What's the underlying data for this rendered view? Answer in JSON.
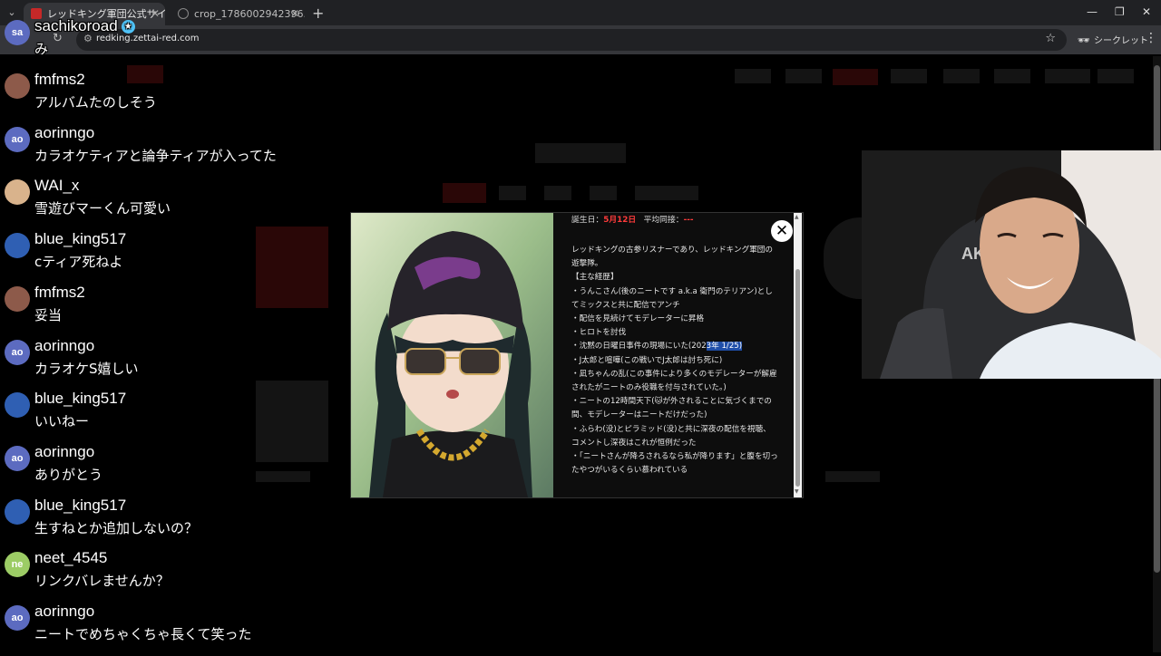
{
  "browser": {
    "tabs": [
      {
        "title": "レッドキング軍団公式サイト",
        "active": true
      },
      {
        "title": "crop_1786002942396.jpg (800×",
        "active": false
      }
    ],
    "url": "redking.zettai-red.com",
    "incognito_label": "シークレット"
  },
  "modal": {
    "birthday_label": "誕生日：",
    "birthday_value": "5月12日",
    "avg_label": "平均同接：",
    "avg_value": "---",
    "intro": "レッドキングの古参リスナーであり、レッドキング軍団の遊撃隊。",
    "section": "【主な経歴】",
    "bullets": [
      "・うんこさん(後のニートです a.k.a 衛門のテリアン)としてミックスと共に配信でアンチ",
      "・配信を見続けてモデレーターに昇格",
      "・ヒロトを討伐",
      "・J太郎と喧嘩(この戦いでJ太郎は討ち死に)",
      "・凪ちゃんの乱(この事件により多くのモデレーターが解雇されたがニートのみ役職を付与されていた。)",
      "・ニートの12時間天下(🐱が外されることに気づくまでの間、モデレーターはニートだけだった)",
      "・ふらわ(没)とピラミッド(没)と共に深夜の配信を視聴、コメントし深夜はこれが恒例だった",
      "・「ニートさんが降ろされるなら私が降ります」と腹を切ったやつがいるくらい慕われている"
    ],
    "silence_prefix": "・沈黙の日曜日事件の現場にいた(202",
    "silence_selected": "3年 1/25)",
    "close_glyph": "✕"
  },
  "chat": [
    {
      "user": "sachikoroad",
      "initials": "sa",
      "avatar_color": "#5c6bc0",
      "text": "み",
      "badge": true
    },
    {
      "user": "fmfms2",
      "initials": "",
      "avatar_color": "#8d5a4a",
      "text": "アルバムたのしそう"
    },
    {
      "user": "aorinngo",
      "initials": "ao",
      "avatar_color": "#5c6bc0",
      "text": "カラオケティアと論争ティアが入ってた"
    },
    {
      "user": "WAI_x",
      "initials": "",
      "avatar_color": "#d9b38c",
      "text": "雪遊びマーくん可愛い"
    },
    {
      "user": "blue_king517",
      "initials": "",
      "avatar_color": "#2f5fb3",
      "text": "cティア死ねよ"
    },
    {
      "user": "fmfms2",
      "initials": "",
      "avatar_color": "#8d5a4a",
      "text": "妥当"
    },
    {
      "user": "aorinngo",
      "initials": "ao",
      "avatar_color": "#5c6bc0",
      "text": "カラオケS嬉しい"
    },
    {
      "user": "blue_king517",
      "initials": "",
      "avatar_color": "#2f5fb3",
      "text": "いいねー"
    },
    {
      "user": "aorinngo",
      "initials": "ao",
      "avatar_color": "#5c6bc0",
      "text": "ありがとう"
    },
    {
      "user": "blue_king517",
      "initials": "",
      "avatar_color": "#2f5fb3",
      "text": "生すねとか追加しないの？"
    },
    {
      "user": "neet_4545",
      "initials": "ne",
      "avatar_color": "#9ccc65",
      "text": "リンクバレませんか？"
    },
    {
      "user": "aorinngo",
      "initials": "ao",
      "avatar_color": "#5c6bc0",
      "text": "ニートでめちゃくちゃ長くて笑った"
    }
  ],
  "colors": {
    "accent_red": "#ff3b3b",
    "selection": "#1f4ea8"
  }
}
